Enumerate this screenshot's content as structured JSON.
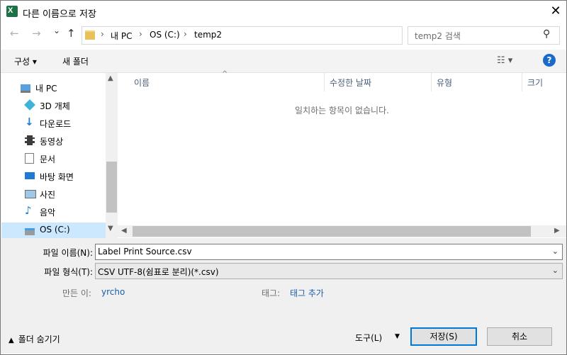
{
  "title_bar": {
    "title": "다른 이름으로 저장",
    "app_icon_letter": "X",
    "close_glyph": "✕"
  },
  "address_bar": {
    "back_glyph": "←",
    "forward_glyph": "→",
    "recent_glyph": "⌄",
    "up_glyph": "↑",
    "crumbs": [
      "내 PC",
      "OS (C:)",
      "temp2"
    ],
    "separator": "›",
    "dropdown_glyph": "⌄",
    "refresh_glyph": "↻"
  },
  "search": {
    "placeholder": "temp2 검색",
    "icon_glyph": "⚲"
  },
  "toolbar": {
    "organize_label": "구성 ▾",
    "new_folder_label": "새 폴더",
    "view_glyph": "☷ ▾",
    "help_glyph": "?"
  },
  "nav_pane": {
    "items": [
      {
        "label": "내 PC",
        "icon": "pc-icon"
      },
      {
        "label": "3D 개체",
        "icon": "cube-icon"
      },
      {
        "label": "다운로드",
        "icon": "download-icon"
      },
      {
        "label": "동영상",
        "icon": "video-icon"
      },
      {
        "label": "문서",
        "icon": "document-icon"
      },
      {
        "label": "바탕 화면",
        "icon": "desktop-icon"
      },
      {
        "label": "사진",
        "icon": "picture-icon"
      },
      {
        "label": "음악",
        "icon": "music-icon"
      },
      {
        "label": "OS (C:)",
        "icon": "drive-icon"
      }
    ],
    "selected_index": 8
  },
  "file_list": {
    "columns": [
      "이름",
      "수정한 날짜",
      "유형",
      "크기"
    ],
    "sort_glyph": "^",
    "empty_message": "일치하는 항목이 없습니다."
  },
  "scroll": {
    "up": "▲",
    "down": "▼",
    "left": "◀",
    "right": "▶"
  },
  "form": {
    "filename_label": "파일 이름(N):",
    "filename_value": "Label Print Source.csv",
    "filetype_label": "파일 형식(T):",
    "filetype_value": "CSV UTF-8(쉼표로 분리)(*.csv)",
    "dropdown_glyph": "⌄",
    "author_label": "만든 이:",
    "author_value": "yrcho",
    "tags_label": "태그:",
    "tags_value": "태그 추가"
  },
  "footer": {
    "hide_folders_label": "폴더 숨기기",
    "hide_folders_glyph": "▲",
    "tools_label": "도구(L)",
    "tools_dd_glyph": "▼",
    "save_label": "저장(S)",
    "cancel_label": "취소"
  },
  "colors": {
    "accent": "#0078d7",
    "selection": "#cce8ff",
    "link": "#1a5ea8",
    "excel_green": "#1e7145"
  }
}
